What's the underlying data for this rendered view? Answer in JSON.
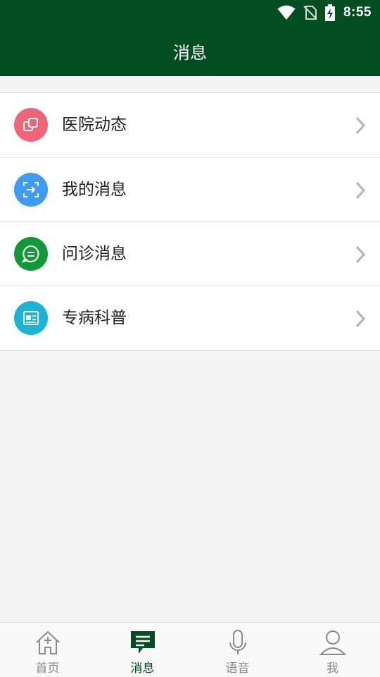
{
  "status_bar": {
    "time": "8:55"
  },
  "header": {
    "title": "消息"
  },
  "menu": {
    "items": [
      {
        "label": "医院动态",
        "icon": "hospital-news-icon",
        "color": "#f0647a"
      },
      {
        "label": "我的消息",
        "icon": "my-message-icon",
        "color": "#3f9bf0"
      },
      {
        "label": "问诊消息",
        "icon": "consult-chat-icon",
        "color": "#129937"
      },
      {
        "label": "专病科普",
        "icon": "newspaper-icon",
        "color": "#1cb4d4"
      }
    ]
  },
  "tabbar": {
    "tabs": [
      {
        "label": "首页",
        "icon": "home-icon"
      },
      {
        "label": "消息",
        "icon": "message-icon",
        "active": true
      },
      {
        "label": "语音",
        "icon": "microphone-icon"
      },
      {
        "label": "我",
        "icon": "person-icon"
      }
    ]
  },
  "colors": {
    "primary": "#034d22",
    "background": "#f4f4f4",
    "inactive_tab": "#8a8a8a"
  }
}
